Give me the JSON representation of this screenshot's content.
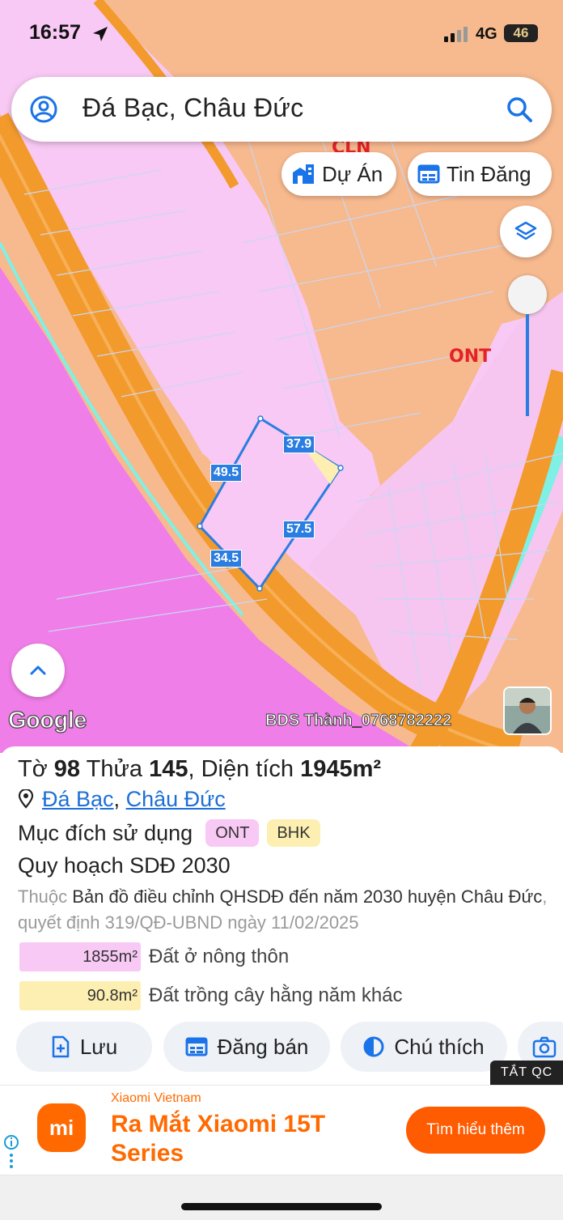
{
  "status_bar": {
    "time": "16:57",
    "network": "4G",
    "battery": "46"
  },
  "search": {
    "value": "Đá Bạc, Châu Đức"
  },
  "chips": {
    "project": "Dự Án",
    "listings": "Tin Đăng"
  },
  "map": {
    "zone_labels": [
      "CLN",
      "ONT"
    ],
    "dimensions": [
      "37.9",
      "49.5",
      "57.5",
      "34.5"
    ],
    "google_logo": "Google",
    "watermark": "BDS Thành_0768782222"
  },
  "parcel": {
    "sheet_label": "Tờ",
    "sheet_no": "98",
    "parcel_label": "Thửa",
    "parcel_no": "145",
    "area_label": "Diện tích",
    "area": "1945m²",
    "address_commune": "Đá Bạc",
    "address_sep": ",",
    "address_district": "Châu Đức",
    "purpose_label": "Mục đích sử dụng",
    "purpose_tags": [
      "ONT",
      "BHK"
    ],
    "plan_title": "Quy hoạch SDĐ 2030",
    "plan_prefix": "Thuộc",
    "plan_doc": "Bản đồ điều chỉnh QHSDĐ đến năm 2030 huyện Châu Đức",
    "plan_suffix": ", quyết định 319/QĐ-UBND ngày 11/02/2025",
    "areas": [
      {
        "value": "1855m²",
        "label": "Đất ở nông thôn",
        "color": "#f8c9f4"
      },
      {
        "value": "90.8m²",
        "label": "Đất trồng cây hằng năm khác",
        "color": "#fcefb1"
      }
    ]
  },
  "actions": {
    "save": "Lưu",
    "post": "Đăng bán",
    "legend": "Chú thích"
  },
  "ads_off": "TẮT QC",
  "ad": {
    "brand": "Xiaomi Vietnam",
    "logo_text": "mi",
    "headline": "Ra Mắt Xiaomi 15T Series",
    "cta": "Tìm hiểu thêm"
  },
  "colors": {
    "accent": "#2a7de1",
    "road": "#f39a2c",
    "residential": "#f8c9f4",
    "perennial": "#f7b98e",
    "ad_orange": "#ff6900"
  }
}
